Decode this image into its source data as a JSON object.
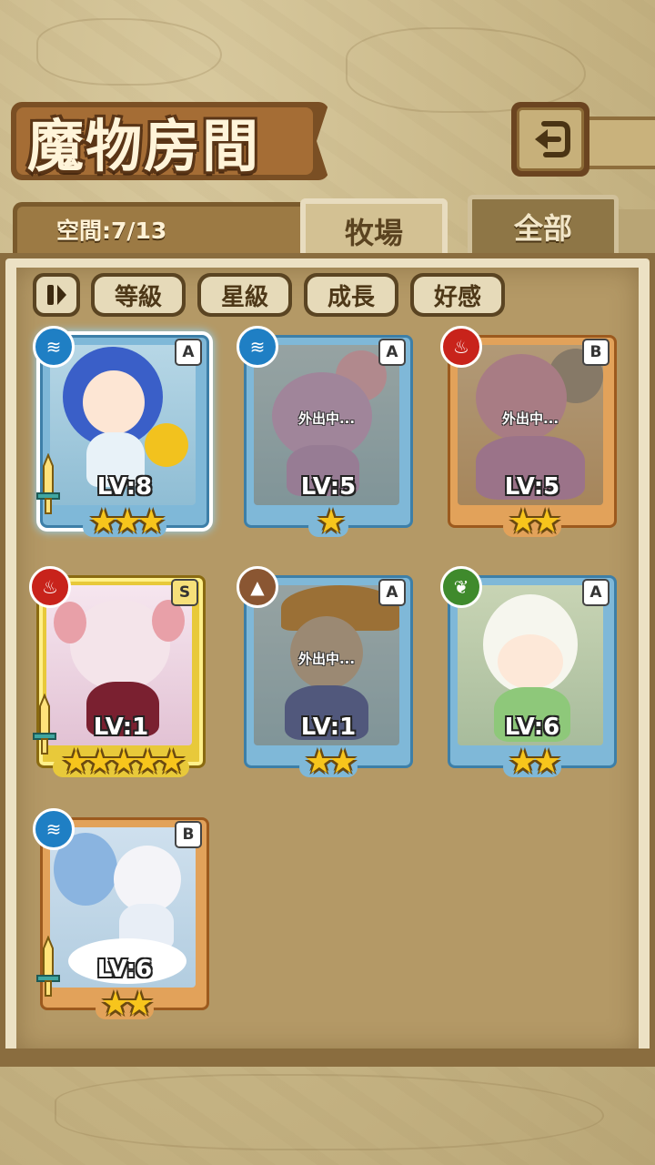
{
  "header": {
    "title": "魔物房間"
  },
  "space": {
    "label": "空間:7/13"
  },
  "tabs": [
    {
      "label": "牧場",
      "active": true
    },
    {
      "label": "全部",
      "active": false
    }
  ],
  "filters": [
    {
      "label": "等級"
    },
    {
      "label": "星級"
    },
    {
      "label": "成長"
    },
    {
      "label": "好感"
    }
  ],
  "monsters": [
    {
      "level": "LV:8",
      "rank": "A",
      "element": "water-icon",
      "stars": "★★★",
      "status": ""
    },
    {
      "level": "LV:5",
      "rank": "A",
      "element": "water-icon",
      "stars": "★",
      "status": "外出中..."
    },
    {
      "level": "LV:5",
      "rank": "B",
      "element": "fire-icon",
      "stars": "★★",
      "status": "外出中..."
    },
    {
      "level": "LV:1",
      "rank": "S",
      "element": "fire-icon",
      "stars": "★★★★★",
      "status": ""
    },
    {
      "level": "LV:1",
      "rank": "A",
      "element": "earth-icon",
      "stars": "★★",
      "status": "外出中..."
    },
    {
      "level": "LV:6",
      "rank": "A",
      "element": "wood-icon",
      "stars": "★★",
      "status": ""
    },
    {
      "level": "LV:6",
      "rank": "B",
      "element": "water-icon",
      "stars": "★★",
      "status": ""
    }
  ],
  "colors": {
    "accent": "#a56d35",
    "water": "#1f7fc4",
    "fire": "#c8231b",
    "earth": "#8a5632",
    "wood": "#3f8a2c",
    "star": "#f7c51c"
  }
}
